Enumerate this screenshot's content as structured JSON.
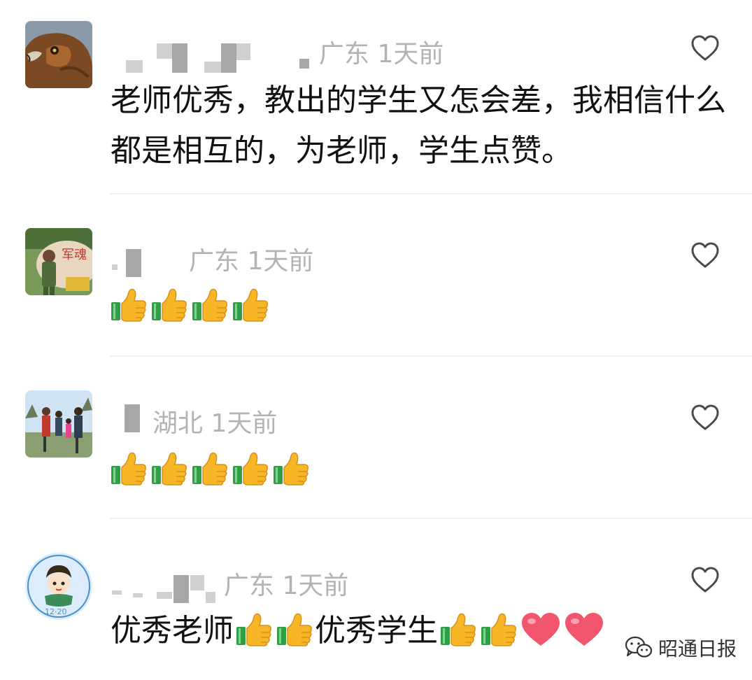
{
  "colors": {
    "meta_text": "#b3b3b3",
    "body_text": "#111111",
    "divider": "#eeeeee",
    "heart_outline": "#4a4a4a",
    "thumb_yellow": "#f6b625",
    "thumb_green": "#2f9e44",
    "red_heart": "#f2566f"
  },
  "comments": [
    {
      "avatar_icon": "hawk-avatar-icon",
      "meta": "广东 1天前",
      "text": "老师优秀，教出的学生又怎会差，我相信什么都是相互的，为老师，学生点赞。",
      "like_icon": "heart-outline-icon"
    },
    {
      "avatar_icon": "soldier-photo-avatar-icon",
      "avatar_text": "军魂",
      "meta": "广东 1天前",
      "thumbs_up_count": 4,
      "like_icon": "heart-outline-icon"
    },
    {
      "avatar_icon": "family-photo-avatar-icon",
      "meta": "湖北 1天前",
      "thumbs_up_count": 5,
      "like_icon": "heart-outline-icon"
    },
    {
      "avatar_icon": "cartoon-boy-avatar-icon",
      "meta": "广东 1天前",
      "text_part1": "优秀老师",
      "text_part2": "优秀学生",
      "emoji_sequence": [
        "thumbs-up-icon",
        "thumbs-up-icon",
        "text_part2",
        "thumbs-up-icon",
        "thumbs-up-icon",
        "red-heart-icon",
        "red-heart-icon"
      ],
      "like_icon": "heart-outline-icon"
    }
  ],
  "watermark": {
    "icon": "wechat-icon",
    "label": "昭通日报"
  }
}
